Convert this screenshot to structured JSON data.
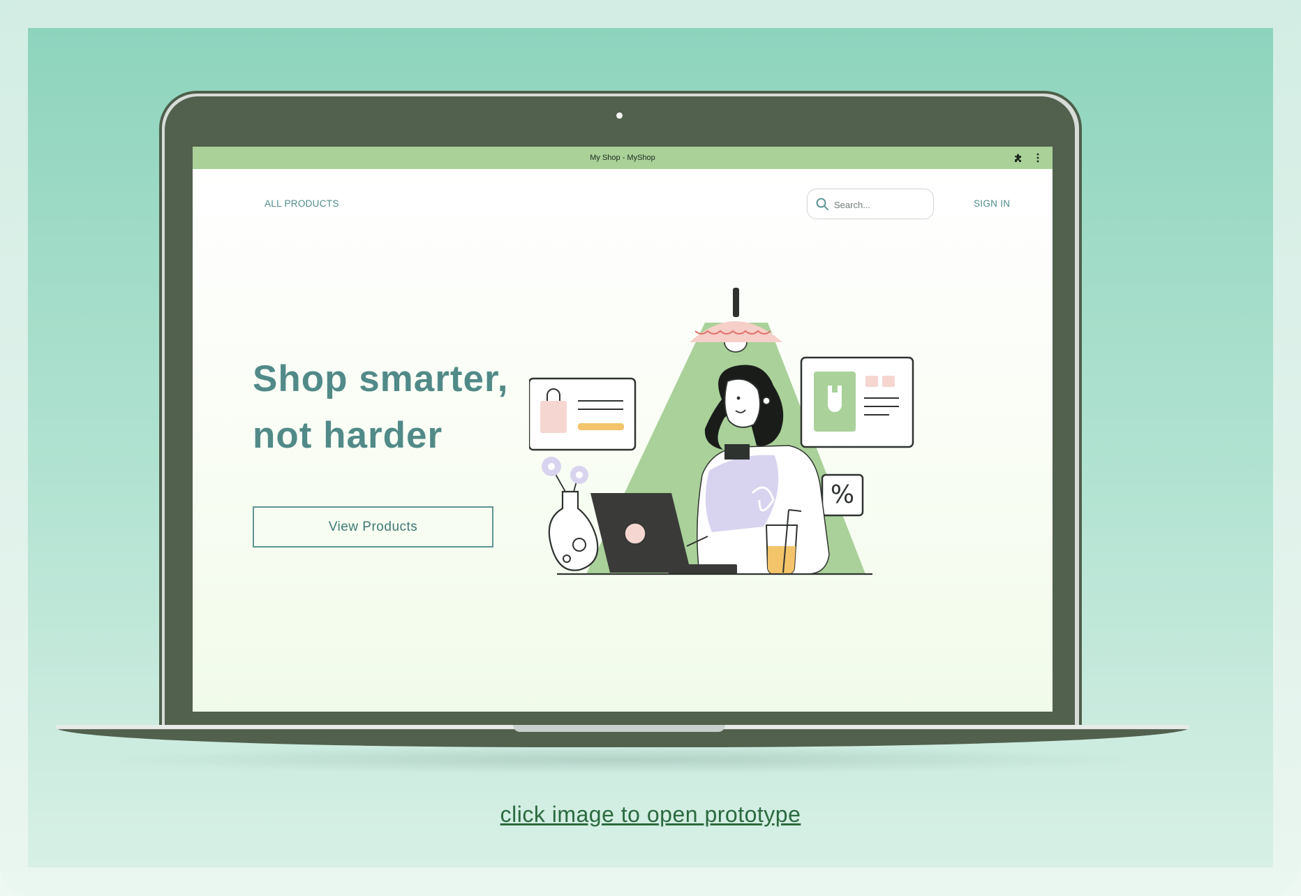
{
  "caption": "click image to open prototype",
  "browser": {
    "title": "My Shop - MyShop",
    "extension_icon": "puzzle-piece-icon",
    "menu_icon": "vertical-ellipsis-icon"
  },
  "nav": {
    "all_products": "ALL PRODUCTS",
    "search": {
      "placeholder": "Search...",
      "value": ""
    },
    "sign_in": "SIGN IN"
  },
  "hero": {
    "headline_line1": "Shop smarter,",
    "headline_line2": "not harder",
    "cta_label": "View Products"
  },
  "colors": {
    "accent_teal": "#518a88",
    "titlebar_green": "#a9d198",
    "laptop_body": "#52604e",
    "caption_link": "#2b6a3f"
  }
}
